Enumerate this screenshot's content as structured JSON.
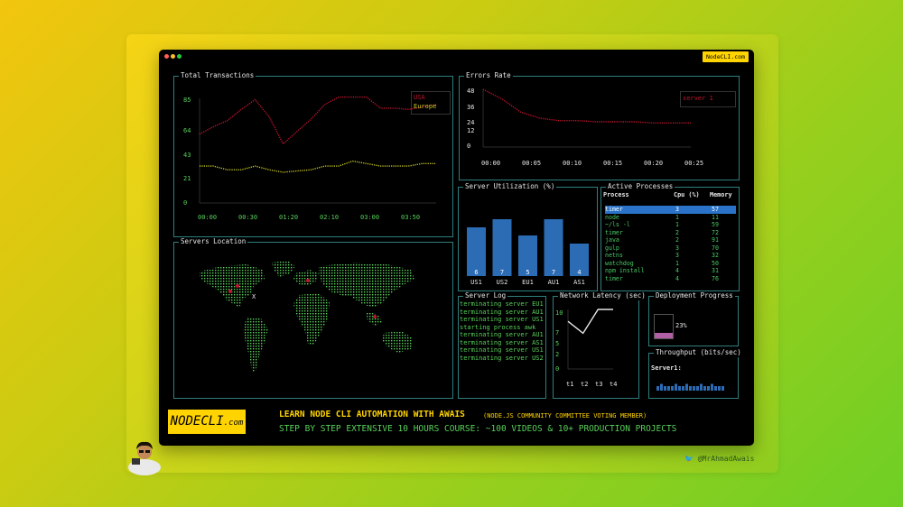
{
  "site_badge": "NodeCLI.com",
  "window": {
    "dots": [
      "#ff5f57",
      "#ffbd2e",
      "#28c840"
    ]
  },
  "colors": {
    "usa": "#c0152d",
    "europe": "#c8c822",
    "border": "#2f7f7f",
    "bar": "#2c6cb5",
    "accent": "#ffd400"
  },
  "transactions": {
    "title": "Total Transactions",
    "legend": [
      "USA",
      "Europe"
    ],
    "yticks": [
      "85",
      "64",
      "43",
      "21",
      "0"
    ],
    "xticks": [
      "00:00",
      "00:30",
      "01:20",
      "02:10",
      "03:00",
      "03:50"
    ],
    "chart_data": {
      "type": "line",
      "title": "Total Transactions",
      "x": [
        "00:00",
        "00:30",
        "01:20",
        "02:10",
        "03:00",
        "03:50"
      ],
      "ylim": [
        0,
        85
      ],
      "series": [
        {
          "name": "USA",
          "values": [
            56,
            62,
            67,
            76,
            84,
            70,
            48,
            58,
            68,
            80,
            86,
            86,
            86,
            77,
            77,
            76,
            78,
            80
          ]
        },
        {
          "name": "Europe",
          "values": [
            30,
            30,
            27,
            27,
            30,
            27,
            25,
            26,
            27,
            30,
            30,
            34,
            32,
            30,
            30,
            30,
            32,
            32
          ]
        }
      ]
    }
  },
  "errors": {
    "title": "Errors Rate",
    "legend": "server 1",
    "yticks": [
      "48",
      "36",
      "24",
      "12",
      "0"
    ],
    "xticks": [
      "00:00",
      "00:05",
      "00:10",
      "00:15",
      "00:20",
      "00:25"
    ],
    "chart_data": {
      "type": "line",
      "title": "Errors Rate",
      "x": [
        "00:00",
        "00:05",
        "00:10",
        "00:15",
        "00:20",
        "00:25"
      ],
      "ylim": [
        0,
        48
      ],
      "series": [
        {
          "name": "server 1",
          "values": [
            48,
            40,
            29,
            24,
            22,
            22,
            21,
            21,
            21,
            20,
            20,
            20
          ]
        }
      ]
    }
  },
  "utilization": {
    "title": "Server Utilization (%)",
    "chart_data": {
      "type": "bar",
      "title": "Server Utilization (%)",
      "categories": [
        "US1",
        "US2",
        "EU1",
        "AU1",
        "AS1"
      ],
      "values": [
        6,
        7,
        5,
        7,
        4
      ],
      "ylim": [
        0,
        8
      ]
    }
  },
  "processes": {
    "title": "Active Processes",
    "headers": [
      "Process",
      "Cpu (%)",
      "Memory"
    ],
    "rows": [
      [
        "timer",
        "3",
        "57"
      ],
      [
        "node",
        "1",
        "11"
      ],
      [
        "~/ls -l",
        "1",
        "59"
      ],
      [
        "timer",
        "2",
        "72"
      ],
      [
        "java",
        "2",
        "91"
      ],
      [
        "gulp",
        "3",
        "70"
      ],
      [
        "netns",
        "3",
        "32"
      ],
      [
        "watchdog",
        "1",
        "50"
      ],
      [
        "npm install",
        "4",
        "31"
      ],
      [
        "timer",
        "4",
        "76"
      ]
    ]
  },
  "location": {
    "title": "Servers Location"
  },
  "log": {
    "title": "Server Log",
    "lines": [
      "terminating server EU1",
      "terminating server AU1",
      "terminating server US1",
      "starting process awk",
      "terminating server AU1",
      "terminating server AS1",
      "terminating server US1",
      "terminating server US2"
    ]
  },
  "latency": {
    "title": "Network Latency (sec)",
    "yticks": [
      "10",
      "7",
      "5",
      "2",
      "0"
    ],
    "xticks": [
      "t1",
      "t2",
      "t3",
      "t4"
    ],
    "chart_data": {
      "type": "line",
      "title": "Network Latency (sec)",
      "x": [
        "t1",
        "t2",
        "t3",
        "t4"
      ],
      "ylim": [
        0,
        10
      ],
      "series": [
        {
          "values": [
            8,
            6,
            10,
            10
          ]
        }
      ]
    }
  },
  "deployment": {
    "title": "Deployment Progress",
    "value": 0.23,
    "label": "23%"
  },
  "throughput": {
    "title": "Throughput (bits/sec)",
    "server_label": "Server1:",
    "values": [
      2,
      3,
      2,
      2,
      2,
      3,
      2,
      2,
      3,
      2,
      2,
      2,
      3,
      2,
      2,
      3,
      2,
      2,
      2
    ]
  },
  "banner": {
    "logo_main": "NODECLI",
    "logo_suffix": ".com",
    "headline": "LEARN NODE CLI AUTOMATION WITH AWAIS",
    "headline_note": "(NODE.JS COMMUNITY COMMITTEE VOTING MEMBER)",
    "subline": "STEP BY STEP EXTENSIVE 10 HOURS COURSE: ~100 VIDEOS & 10+ PRODUCTION PROJECTS"
  },
  "footer": {
    "handle": "@MrAhmadAwais",
    "bird_icon": "twitter-bird-icon"
  }
}
